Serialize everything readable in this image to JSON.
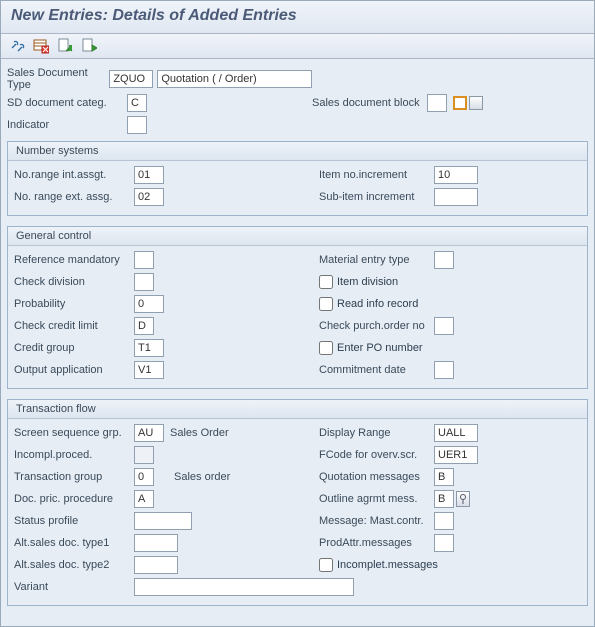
{
  "title": "New Entries: Details of Added Entries",
  "header": {
    "sales_doc_type_lbl": "Sales Document Type",
    "sales_doc_type": "ZQUO",
    "sales_doc_type_desc": "Quotation ( / Order)",
    "sd_doc_categ_lbl": "SD document categ.",
    "sd_doc_categ": "C",
    "sales_doc_block_lbl": "Sales document block",
    "sales_doc_block": "",
    "indicator_lbl": "Indicator",
    "indicator": ""
  },
  "number_systems": {
    "title": "Number systems",
    "int_lbl": "No.range int.assgt.",
    "int": "01",
    "ext_lbl": "No. range ext. assg.",
    "ext": "02",
    "item_incr_lbl": "Item no.increment",
    "item_incr": "10",
    "sub_incr_lbl": "Sub-item increment",
    "sub_incr": ""
  },
  "general_control": {
    "title": "General control",
    "ref_mand_lbl": "Reference mandatory",
    "ref_mand": "",
    "mat_entry_lbl": "Material entry type",
    "mat_entry": "",
    "check_div_lbl": "Check division",
    "check_div": "",
    "item_div_lbl": "Item division",
    "item_div": false,
    "prob_lbl": "Probability",
    "prob": "0",
    "read_info_lbl": "Read info record",
    "read_info": false,
    "check_credit_lbl": "Check credit limit",
    "check_credit": "D",
    "check_po_lbl": "Check purch.order no",
    "check_po": "",
    "credit_grp_lbl": "Credit group",
    "credit_grp": "T1",
    "enter_po_lbl": "Enter PO number",
    "enter_po": false,
    "output_app_lbl": "Output application",
    "output_app": "V1",
    "commit_date_lbl": "Commitment  date",
    "commit_date": ""
  },
  "transaction_flow": {
    "title": "Transaction flow",
    "screen_seq_lbl": "Screen sequence grp.",
    "screen_seq": "AU",
    "screen_seq_txt": "Sales Order",
    "disp_range_lbl": "Display Range",
    "disp_range": "UALL",
    "incompl_lbl": "Incompl.proced.",
    "incompl": "",
    "fcode_lbl": "FCode for overv.scr.",
    "fcode": "UER1",
    "trans_grp_lbl": "Transaction group",
    "trans_grp": "0",
    "trans_grp_txt": "Sales order",
    "quot_msg_lbl": "Quotation messages",
    "quot_msg": "B",
    "doc_pric_lbl": "Doc. pric. procedure",
    "doc_pric": "A",
    "outline_msg_lbl": "Outline agrmt mess.",
    "outline_msg": "B",
    "status_prof_lbl": "Status profile",
    "status_prof": "",
    "msg_mast_lbl": "Message: Mast.contr.",
    "msg_mast": "",
    "alt1_lbl": "Alt.sales doc. type1",
    "alt1": "",
    "prodattr_lbl": "ProdAttr.messages",
    "prodattr": "",
    "alt2_lbl": "Alt.sales doc. type2",
    "alt2": "",
    "incompl_msg_lbl": "Incomplet.messages",
    "incompl_msg": false,
    "variant_lbl": "Variant",
    "variant": ""
  }
}
